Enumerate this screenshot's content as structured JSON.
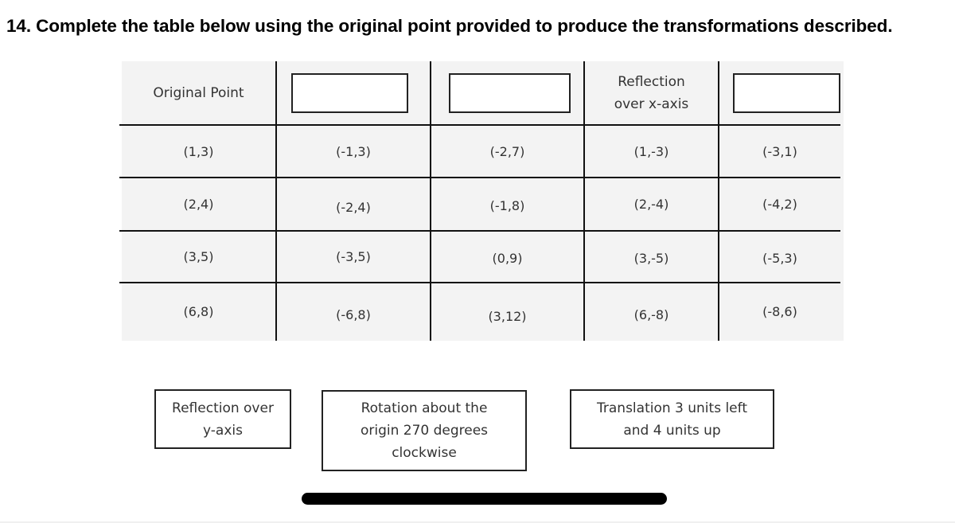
{
  "question": {
    "text": "14. Complete the table below using the original point provided to produce the transformations described."
  },
  "table": {
    "headers": [
      {
        "label": "Original Point",
        "type": "text"
      },
      {
        "label": "",
        "type": "drop-target"
      },
      {
        "label": "",
        "type": "drop-target"
      },
      {
        "label": "Reflection over x-axis",
        "line1": "Reflection",
        "line2": "over x-axis",
        "type": "text"
      },
      {
        "label": "",
        "type": "drop-target"
      }
    ],
    "rows": [
      [
        "(1,3)",
        "(-1,3)",
        "(-2,7)",
        "(1,-3)",
        "(-3,1)"
      ],
      [
        "(2,4)",
        "(-2,4)",
        "(-1,8)",
        "(2,-4)",
        "(-4,2)"
      ],
      [
        "(3,5)",
        "(-3,5)",
        "(0,9)",
        "(3,-5)",
        "(-5,3)"
      ],
      [
        "(6,8)",
        "(-6,8)",
        "(3,12)",
        "(6,-8)",
        "(-8,6)"
      ]
    ]
  },
  "draggable_labels": [
    {
      "line1": "Reflection over",
      "line2": "y-axis",
      "line3": ""
    },
    {
      "line1": "Rotation about the",
      "line2": "origin 270 degrees",
      "line3": "clockwise"
    },
    {
      "line1": "Translation 3 units left",
      "line2": "and 4 units up",
      "line3": ""
    }
  ]
}
